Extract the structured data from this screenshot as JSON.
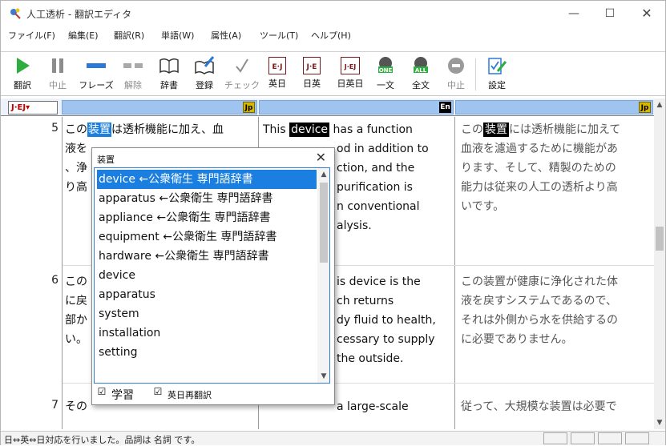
{
  "window": {
    "title": "人工透析 - 翻訳エディタ",
    "minimize": "—",
    "maximize": "☐",
    "close": "✕"
  },
  "menu": [
    "ファイル(F)",
    "編集(E)",
    "翻訳(R)",
    "単語(W)",
    "属性(A)",
    "ツール(T)",
    "ヘルプ(H)"
  ],
  "toolbar": {
    "translate": "翻訳",
    "stop": "中止",
    "phrase": "フレーズ",
    "release": "解除",
    "dictionary": "辞書",
    "register": "登録",
    "check": "チェック",
    "eng_jp": "英日",
    "jp_eng": "日英",
    "jp_eng_jp": "日英日",
    "one_sentence": "一文",
    "all_sentences": "全文",
    "stop2": "中止",
    "settings": "設定",
    "badge_ej": "E·J",
    "badge_je": "J·E",
    "badge_jej": "J·EJ",
    "badge_one": "ONE",
    "badge_all": "ALL"
  },
  "pane_header": {
    "language_mode": "J·EJ▾",
    "col1_badge": "Jp",
    "col2_badge": "En",
    "col3_badge": "Jp"
  },
  "rows": [
    {
      "num": "5",
      "src_pre": "この",
      "src_hl": "装置",
      "src_post": "は透析機能に加え、血",
      "src_lines": [
        "液を",
        "、浄",
        "り高"
      ],
      "en_pre": "This ",
      "en_hl": "device",
      "en_post": " has a function",
      "en_lines": [
        "od in addition to",
        "ction, and the",
        "purification is",
        "n conventional",
        "alysis."
      ],
      "ref_pre": "この",
      "ref_hl": "装置",
      "ref_post": "には透析機能に加えて",
      "ref_lines": [
        "血液を濾過するために機能があ",
        "ります、そして、精製のための",
        "能力は従来の人工の透析より高",
        "いです。"
      ]
    },
    {
      "num": "6",
      "src_lines": [
        "この",
        "に戻",
        "部か",
        "い。"
      ],
      "en_lines": [
        "is device is the",
        "ch returns",
        "dy fluid to health,",
        "cessary to supply",
        " the outside."
      ],
      "ref_lines": [
        "この装置が健康に浄化された体",
        "液を戻すシステムであるので、",
        "それは外側から水を供給するの",
        "に必要でありません。"
      ]
    },
    {
      "num": "7",
      "src_lines": [
        "その"
      ],
      "en_lines": [
        "a large-scale"
      ],
      "ref_lines": [
        "従って、大規模な装置は必要で"
      ]
    }
  ],
  "popup": {
    "title": "装置",
    "close": "✕",
    "items": [
      "device ←公衆衛生 専門語辞書",
      "apparatus ←公衆衛生 専門語辞書",
      "appliance ←公衆衛生 専門語辞書",
      "equipment ←公衆衛生 専門語辞書",
      "hardware ←公衆衛生 専門語辞書",
      "device",
      "apparatus",
      "system",
      "installation",
      "setting"
    ],
    "selected_index": 0,
    "learn_label": "学習",
    "learn_checked": "☑",
    "retranslate_label": "英日再翻訳",
    "retranslate_checked": "☑"
  },
  "status": {
    "text": "日⇔英⇔日対応を行いました。品詞は 名詞 です。"
  },
  "colors": {
    "selection": "#1a7fe0",
    "header_blue": "#9ec4ef",
    "highlight": "#000000"
  }
}
